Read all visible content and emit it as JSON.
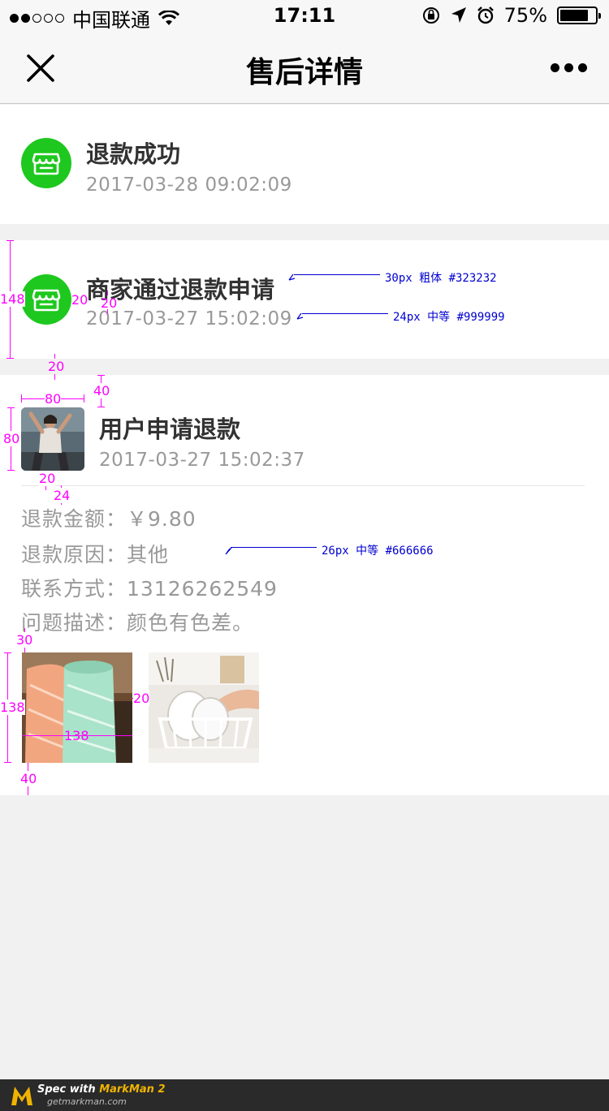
{
  "status_bar": {
    "carrier": "中国联通",
    "time": "17:11",
    "battery": "75%"
  },
  "nav": {
    "title": "售后详情"
  },
  "events": [
    {
      "title": "退款成功",
      "time": "2017-03-28   09:02:09"
    },
    {
      "title": "商家通过退款申请",
      "time": "2017-03-27   15:02:09"
    },
    {
      "title": "用户申请退款",
      "time": "2017-03-27   15:02:37"
    }
  ],
  "refund": {
    "amount": "退款金额：￥9.80",
    "reason": "退款原因：其他",
    "contact": "联系方式：13126262549",
    "description": "问题描述：颜色有色差。"
  },
  "annotations": {
    "title_spec": "30px  粗体  #323232",
    "time_spec": "24px  中等  #999999",
    "info_spec": "26px  中等  #666666",
    "h148": "148",
    "w20a": "20",
    "w20b": "20",
    "gap20": "20",
    "gap40": "40",
    "w80": "80",
    "h80": "80",
    "w20c": "20",
    "w24": "24",
    "gap30": "30",
    "h138": "138",
    "w138": "138",
    "gap20b": "20",
    "gap40b": "40"
  },
  "footer": {
    "spec_prefix": "Spec with ",
    "spec_brand": "MarkMan 2",
    "url": "getmarkman.com"
  },
  "colors": {
    "green": "#1ec81e",
    "title": "#323232",
    "muted": "#999999",
    "annotation": "#ff00ff"
  }
}
